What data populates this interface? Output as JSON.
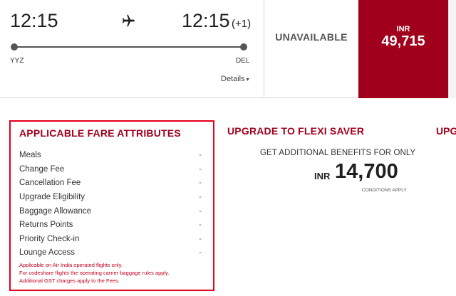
{
  "flight": {
    "departure_time": "12:15",
    "arrival_time": "12:15",
    "day_offset": "(+1)",
    "origin_code": "YYZ",
    "destination_code": "DEL",
    "details_label": "Details",
    "details_caret": "▾"
  },
  "fares": {
    "unavailable_label": "UNAVAILABLE",
    "currency": "INR",
    "price": "49,715"
  },
  "fare_attributes": {
    "title": "APPLICABLE FARE ATTRIBUTES",
    "items": [
      {
        "label": "Meals",
        "value": "-"
      },
      {
        "label": "Change Fee",
        "value": "-"
      },
      {
        "label": "Cancellation Fee",
        "value": "-"
      },
      {
        "label": "Upgrade Eligibility",
        "value": "-"
      },
      {
        "label": "Baggage Allowance",
        "value": "-"
      },
      {
        "label": "Returns Points",
        "value": "-"
      },
      {
        "label": "Priority Check-in",
        "value": "-"
      },
      {
        "label": "Lounge Access",
        "value": "-"
      }
    ],
    "notes": [
      "Applicable on Air India operated flights only.",
      "For codeshare flights the operating carrier baggage rules apply.",
      "Additional GST charges apply to the Fees."
    ]
  },
  "upgrade": {
    "title": "UPGRADE TO FLEXI SAVER",
    "title_next": "UPG",
    "benefit_text": "GET ADDITIONAL BENEFITS FOR ONLY",
    "currency": "INR",
    "amount": "14,700",
    "conditions": "CONDITIONS APPLY"
  },
  "colors": {
    "brand_red": "#a1001c",
    "highlight_border": "#e4001b"
  }
}
